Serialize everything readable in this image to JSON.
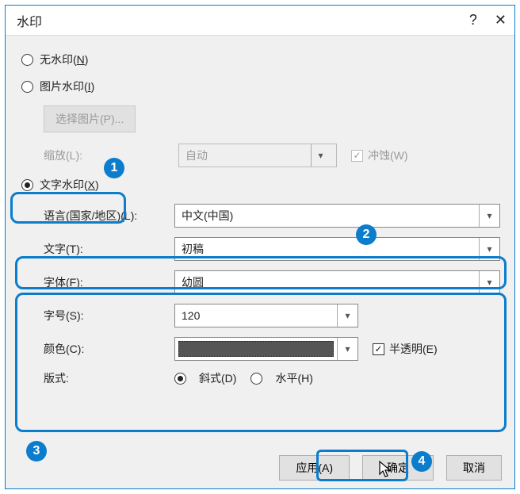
{
  "title": "水印",
  "help_icon": "?",
  "close_icon": "✕",
  "radio_none": {
    "label": "无水印(",
    "accel": "N",
    "suffix": ")"
  },
  "radio_picture": {
    "label": "图片水印(",
    "accel": "I",
    "suffix": ")"
  },
  "select_picture_btn": "选择图片(P)...",
  "scale": {
    "label": "缩放(",
    "accel": "L",
    "suffix": "):",
    "value": "自动"
  },
  "washout": {
    "label": "冲蚀(",
    "accel": "W",
    "suffix": ")"
  },
  "radio_text": {
    "label": "文字水印(",
    "accel": "X",
    "suffix": ")"
  },
  "language": {
    "label": "语言(国家/地区)(",
    "accel": "L",
    "suffix": "):",
    "value": "中文(中国)"
  },
  "text": {
    "label": "文字(",
    "accel": "T",
    "suffix": "):",
    "value": "初稿"
  },
  "font": {
    "label": "字体(",
    "accel": "F",
    "suffix": "):",
    "value": "幼圆"
  },
  "size": {
    "label": "字号(",
    "accel": "S",
    "suffix": "):",
    "value": "120"
  },
  "color": {
    "label": "颜色(",
    "accel": "C",
    "suffix": "):",
    "hex": "#555555"
  },
  "semi": {
    "label": "半透明(",
    "accel": "E",
    "suffix": ")"
  },
  "layout": {
    "label": "版式:",
    "diagonal": {
      "label": "斜式(",
      "accel": "D",
      "suffix": ")"
    },
    "horizontal": {
      "label": "水平(",
      "accel": "H",
      "suffix": ")"
    }
  },
  "buttons": {
    "apply": "应用(A)",
    "ok": "确定",
    "cancel": "取消"
  },
  "badges": {
    "b1": "1",
    "b2": "2",
    "b3": "3",
    "b4": "4"
  }
}
